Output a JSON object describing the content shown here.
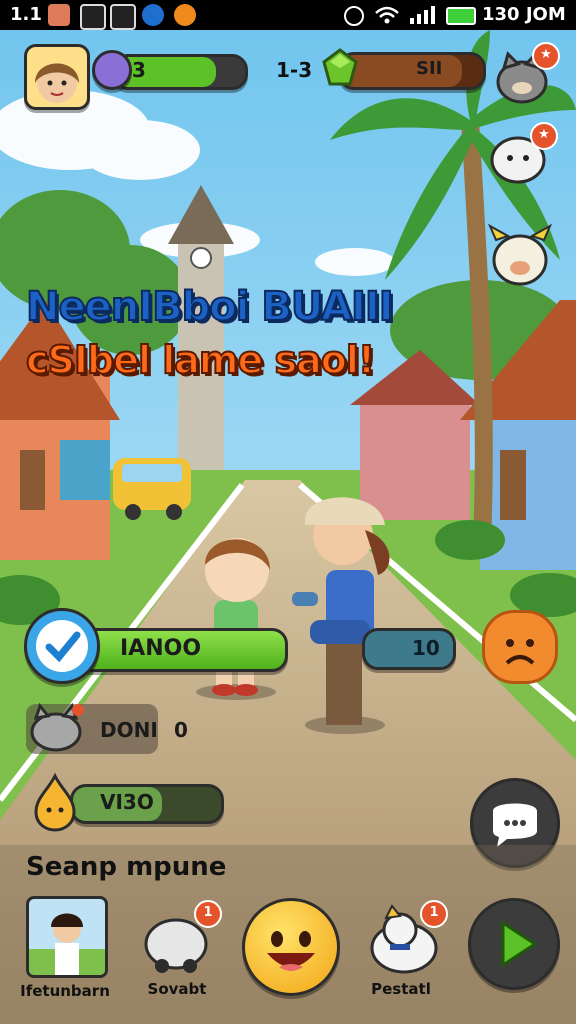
{
  "status_bar": {
    "left_text": "1.1",
    "time": "130 JOM",
    "icons": [
      "notification-icon",
      "gallery-icon",
      "alert-icon",
      "wheel-icon",
      "fox-icon"
    ],
    "right_icons": [
      "settings-icon",
      "wifi-icon",
      "signal-icon",
      "battery-icon"
    ]
  },
  "hud": {
    "level_value": "3",
    "level_fill": 0.78,
    "middle_text": "1-3",
    "gem_value": "SII",
    "gem_fill": 0.85
  },
  "title": {
    "line1": "NeenIBboi BUAIII",
    "line2": "cSIbel lame saol!"
  },
  "panels": {
    "check_value": "IANOO",
    "check_fill": 1.0,
    "side_value": "10",
    "pet_row_label": "DONI",
    "pet_row_value": "0",
    "pear_value": "VI3O",
    "pear_fill": 0.6
  },
  "bottom": {
    "section_title": "Seanp mpune",
    "items": [
      {
        "label": "Ifetunbarn",
        "icon": "kid-portrait-icon"
      },
      {
        "label": "Sovabt",
        "icon": "toy-car-icon",
        "badge": "1"
      },
      {
        "label": "",
        "icon": "smile-face-icon"
      },
      {
        "label": "Pestatl",
        "icon": "puppy-icon",
        "badge": "1"
      }
    ],
    "play_icon": "play-icon",
    "chat_icon": "chat-icon"
  },
  "colors": {
    "sky": "#8fd2f0",
    "green_bar": "#5cc227",
    "brown_bar": "#8a4a22",
    "teal_bar": "#3d7a8c",
    "road": "#c8b08a"
  }
}
